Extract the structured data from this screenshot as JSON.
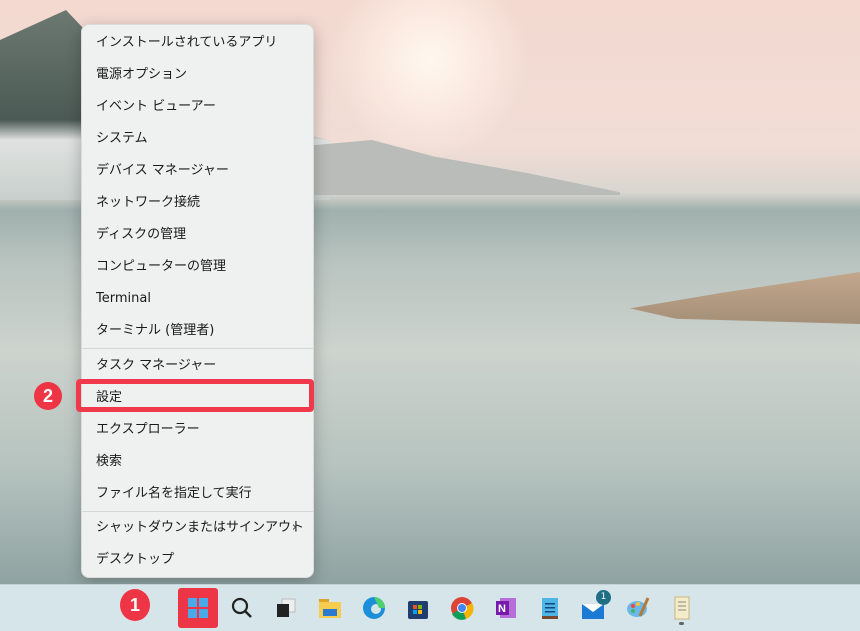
{
  "menu": {
    "items": [
      {
        "label": "インストールされているアプリ"
      },
      {
        "label": "電源オプション"
      },
      {
        "label": "イベント ビューアー"
      },
      {
        "label": "システム"
      },
      {
        "label": "デバイス マネージャー"
      },
      {
        "label": "ネットワーク接続"
      },
      {
        "label": "ディスクの管理"
      },
      {
        "label": "コンピューターの管理"
      },
      {
        "label": "Terminal"
      },
      {
        "label": "ターミナル (管理者)"
      },
      {
        "label": "タスク マネージャー"
      },
      {
        "label": "設定"
      },
      {
        "label": "エクスプローラー"
      },
      {
        "label": "検索"
      },
      {
        "label": "ファイル名を指定して実行"
      },
      {
        "label": "シャットダウンまたはサインアウト",
        "chevron": "›"
      },
      {
        "label": "デスクトップ"
      }
    ]
  },
  "annotations": {
    "step1": "1",
    "step2": "2"
  },
  "taskbar": {
    "mail_badge": "1",
    "icons": [
      "start-icon",
      "search-icon",
      "task-view-icon",
      "file-explorer-icon",
      "edge-icon",
      "store-icon",
      "chrome-icon",
      "onenote-icon",
      "notepad-icon",
      "mail-icon",
      "paint-icon",
      "notes-icon"
    ]
  },
  "colors": {
    "highlight": "#f0394b",
    "badge": "#ee3545"
  }
}
